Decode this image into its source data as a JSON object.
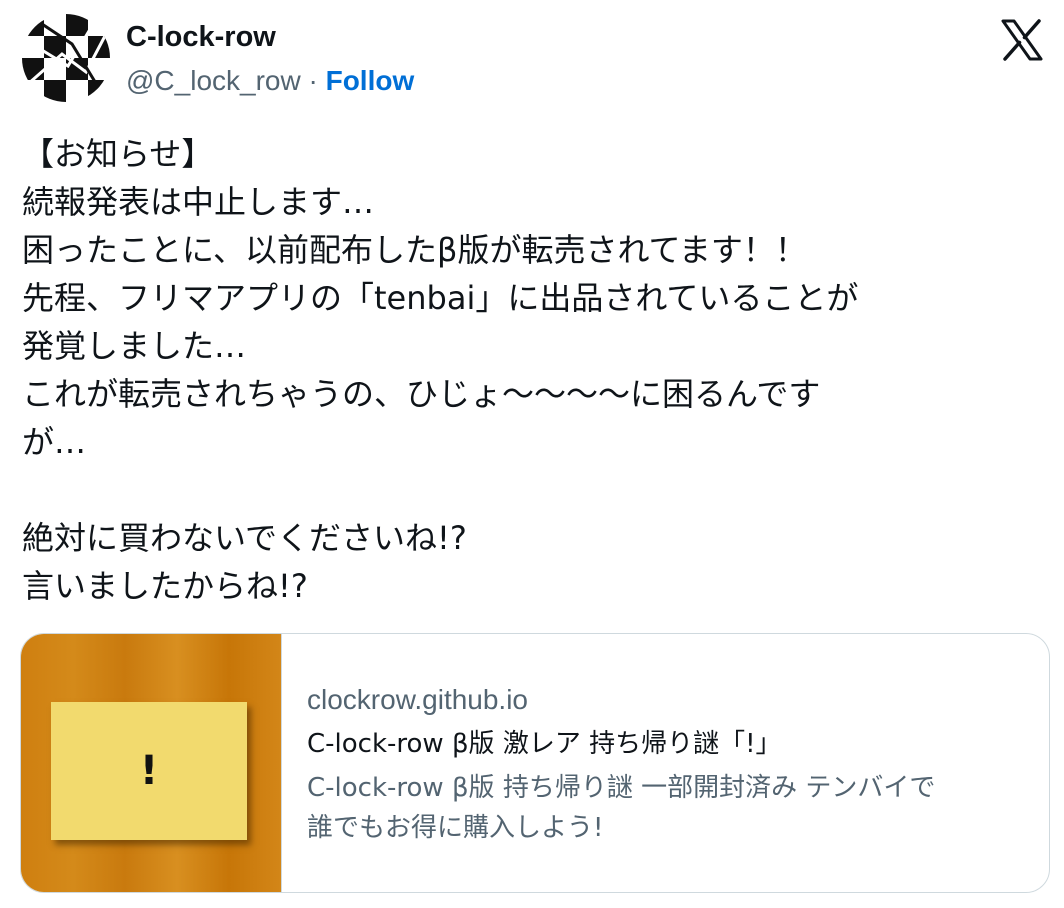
{
  "author": {
    "display_name": "C-lock-row",
    "handle": "@C_lock_row",
    "separator": "·",
    "follow_label": "Follow",
    "avatar_icon": "checkered-clock-avatar"
  },
  "platform": {
    "logo_icon": "x-logo-icon"
  },
  "tweet": {
    "lines": [
      "【お知らせ】",
      "続報発表は中止します…",
      "困ったことに、以前配布したβ版が転売されてます！！",
      "先程、フリマアプリの「tenbai」に出品されていることが",
      "発覚しました…",
      "これが転売されちゃうの、ひじょ〜〜〜〜に困るんです",
      "が…",
      "",
      "絶対に買わないでくださいね!?",
      "言いましたからね!?"
    ]
  },
  "link_card": {
    "image_text": "!",
    "domain": "clockrow.github.io",
    "title": "C-lock-row β版 激レア 持ち帰り謎「!」",
    "description_lines": [
      "C-lock-row β版 持ち帰り謎 一部開封済み テンバイで",
      "誰でもお得に購入しよう!"
    ]
  },
  "colors": {
    "text": "#0f1419",
    "secondary": "#536471",
    "follow": "#006fd6",
    "card_border": "#cfd9de",
    "wood": "#cf7f10",
    "sticky_note": "#f2da6e"
  }
}
